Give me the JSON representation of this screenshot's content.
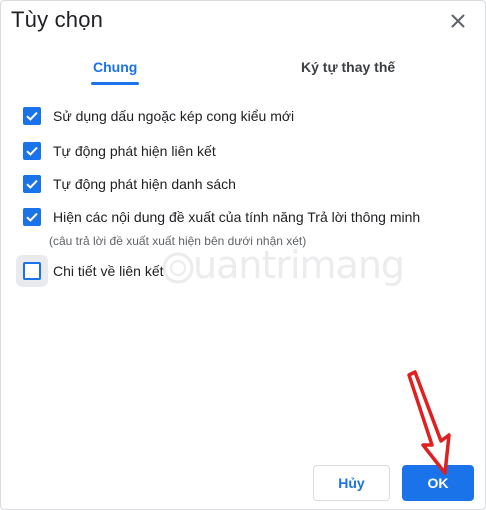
{
  "dialog": {
    "title": "Tùy chọn",
    "close_icon": "close-icon"
  },
  "tabs": [
    {
      "label": "Chung",
      "active": true
    },
    {
      "label": "Ký tự thay thế",
      "active": false
    }
  ],
  "options": [
    {
      "label": "Sử dụng dấu ngoặc kép cong kiểu mới",
      "checked": true
    },
    {
      "label": "Tự động phát hiện liên kết",
      "checked": true
    },
    {
      "label": "Tự động phát hiện danh sách",
      "checked": true
    },
    {
      "label": "Hiện các nội dung đề xuất của tính năng Trả lời thông minh",
      "checked": true
    },
    {
      "label": "Chi tiết về liên kết",
      "checked": false
    }
  ],
  "smart_reply_note": "(câu trả lời đề xuất xuất hiện bên dưới nhận xét)",
  "watermark": {
    "text": "uantrimang"
  },
  "buttons": {
    "cancel": "Hủy",
    "ok": "OK"
  },
  "colors": {
    "accent": "#1a73e8",
    "annotation_arrow": "#e02020"
  }
}
